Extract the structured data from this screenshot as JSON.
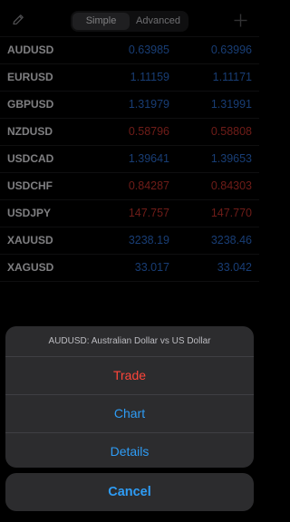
{
  "segmented": {
    "simple": "Simple",
    "advanced": "Advanced",
    "selected": "Simple"
  },
  "quotes": [
    {
      "symbol": "AUDUSD",
      "bid": "0.63985",
      "ask": "0.63996",
      "direction": "up"
    },
    {
      "symbol": "EURUSD",
      "bid": "1.11159",
      "ask": "1.11171",
      "direction": "up"
    },
    {
      "symbol": "GBPUSD",
      "bid": "1.31979",
      "ask": "1.31991",
      "direction": "up"
    },
    {
      "symbol": "NZDUSD",
      "bid": "0.58796",
      "ask": "0.58808",
      "direction": "down"
    },
    {
      "symbol": "USDCAD",
      "bid": "1.39641",
      "ask": "1.39653",
      "direction": "up"
    },
    {
      "symbol": "USDCHF",
      "bid": "0.84287",
      "ask": "0.84303",
      "direction": "down"
    },
    {
      "symbol": "USDJPY",
      "bid": "147.757",
      "ask": "147.770",
      "direction": "down"
    },
    {
      "symbol": "XAUUSD",
      "bid": "3238.19",
      "ask": "3238.46",
      "direction": "up"
    },
    {
      "symbol": "XAGUSD",
      "bid": "33.017",
      "ask": "33.042",
      "direction": "up"
    }
  ],
  "action_sheet": {
    "title": "AUDUSD: Australian Dollar vs US Dollar",
    "trade": "Trade",
    "chart": "Chart",
    "details": "Details",
    "cancel": "Cancel"
  },
  "icons": {
    "edit": "pencil-icon",
    "add": "plus-icon"
  },
  "colors": {
    "up": "#2d6fd3",
    "down": "#c8342c",
    "sheet_action": "#2e9cf5",
    "sheet_trade": "#ff453a"
  }
}
